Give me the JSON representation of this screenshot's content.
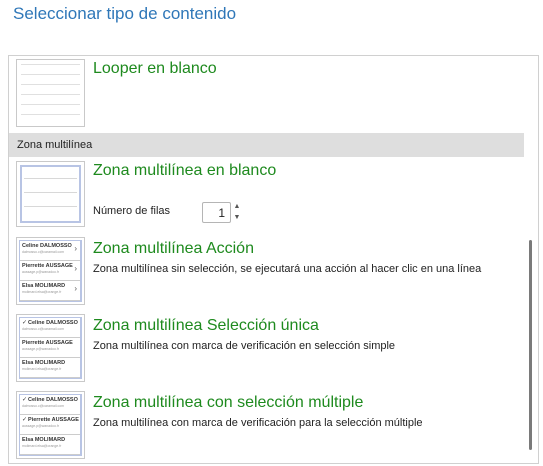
{
  "dialog": {
    "title": "Seleccionar tipo de contenido"
  },
  "items": {
    "looper_blank": {
      "title": "Looper en blanco"
    },
    "section": {
      "label": "Zona multilínea"
    },
    "mlz_blank": {
      "title": "Zona multilínea en blanco",
      "rows_label": "Número de filas",
      "rows_value": "1"
    },
    "mlz_action": {
      "title": "Zona multilínea Acción",
      "description": "Zona multilínea sin selección, se ejecutará una acción al hacer clic en una línea"
    },
    "mlz_single": {
      "title": "Zona multilínea Selección única",
      "description": "Zona multilínea con marca de verificación en selección simple"
    },
    "mlz_multi": {
      "title": "Zona multilínea con selección múltiple",
      "description": "Zona multilínea con marca de verificación para la selección múltiple"
    }
  },
  "preview": {
    "rows": [
      {
        "name": "Celine DALMOSSO",
        "sub": "dalmosso.c@caramail.com"
      },
      {
        "name": "Pierrette AUSSAGE",
        "sub": "aussage.p@wanadoo.fr"
      },
      {
        "name": "Elsa MOLIMARD",
        "sub": "molimard.elsa@orange.fr"
      }
    ]
  },
  "icons": {
    "stepper_up": "▲",
    "stepper_down": "▼",
    "chevron": "›",
    "check": "✓"
  },
  "colors": {
    "title_blue": "#2f77b8",
    "item_green": "#1e8a1e",
    "section_bg": "#dedede"
  }
}
